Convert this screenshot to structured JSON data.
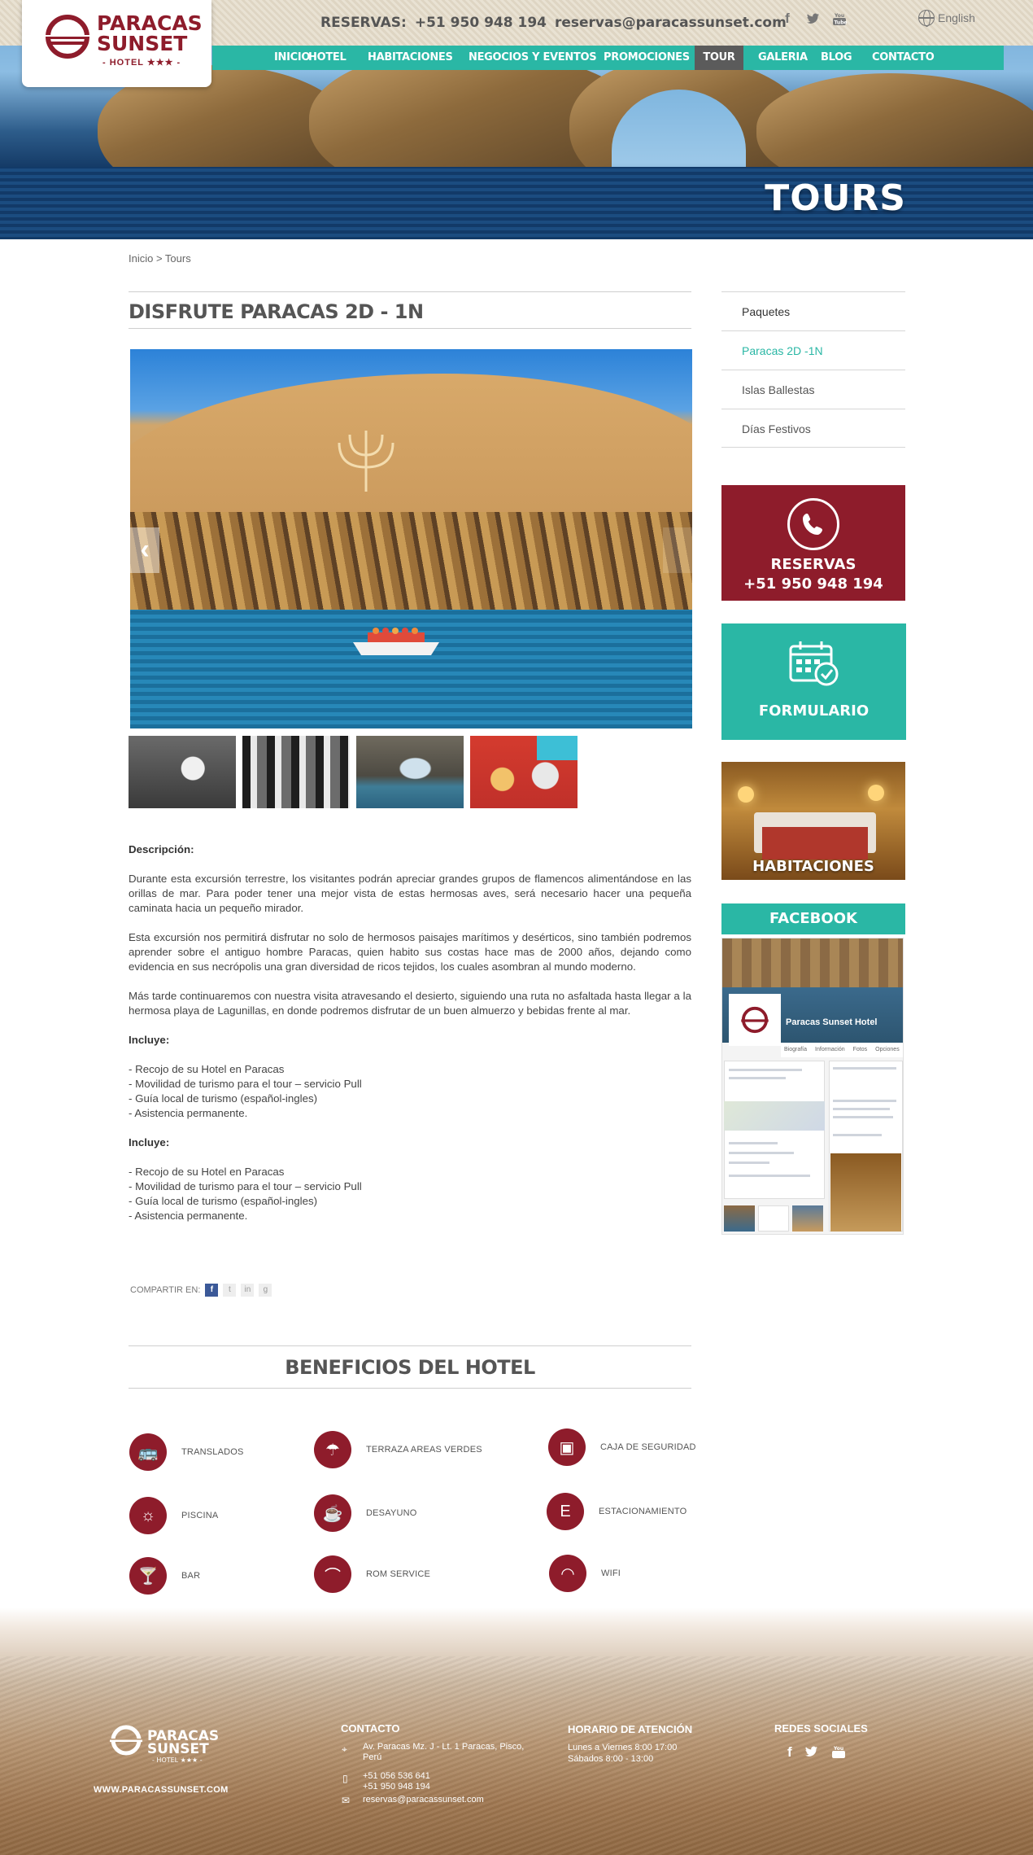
{
  "header": {
    "logo": {
      "line1": "PARACAS",
      "line2": "SUNSET",
      "sub": "- HOTEL ★★★ -"
    },
    "reservas_label": "RESERVAS:",
    "phone": "+51 950 948 194",
    "email": "reservas@paracassunset.com",
    "social_icons": [
      "facebook-icon",
      "twitter-icon",
      "youtube-icon"
    ],
    "language": "English",
    "nav": [
      {
        "label": "INICIO",
        "active": false
      },
      {
        "label": "HOTEL",
        "active": false
      },
      {
        "label": "HABITACIONES",
        "active": false
      },
      {
        "label": "NEGOCIOS Y EVENTOS",
        "active": false
      },
      {
        "label": "PROMOCIONES",
        "active": false
      },
      {
        "label": "TOUR",
        "active": true
      },
      {
        "label": "GALERIA",
        "active": false
      },
      {
        "label": "BLOG",
        "active": false
      },
      {
        "label": "CONTACTO",
        "active": false
      }
    ],
    "hero_title": "TOURS"
  },
  "breadcrumb": "Inicio > Tours",
  "main": {
    "title": "DISFRUTE PARACAS 2D - 1N",
    "description_heading": "Descripción:",
    "paragraphs": [
      "Durante esta excursión terrestre, los visitantes podrán apreciar grandes grupos de flamencos alimentándose en las orillas de mar. Para poder tener una mejor vista de estas hermosas aves, será necesario hacer una pequeña caminata hacia un pequeño mirador.",
      "Esta excursión nos permitirá disfrutar no solo de hermosos paisajes marítimos y desérticos, sino también podremos aprender sobre el antiguo hombre Paracas, quien habito sus costas hace mas de 2000 años, dejando como evidencia en sus necrópolis una gran diversidad de ricos tejidos, los cuales asombran al mundo moderno.",
      "Más tarde continuaremos con nuestra visita atravesando el desierto, siguiendo una ruta no asfaltada hasta llegar a la hermosa playa de Lagunillas, en donde podremos disfrutar de un buen almuerzo y bebidas frente al mar."
    ],
    "includes_heading_1": "Incluye:",
    "includes_1": [
      "- Recojo de su Hotel en Paracas",
      "- Movilidad de turismo para el tour – servicio Pull",
      "- Guía local de turismo (español-ingles)",
      "- Asistencia permanente."
    ],
    "includes_heading_2": "Incluye:",
    "includes_2": [
      "- Recojo de su Hotel en Paracas",
      "- Movilidad de turismo para el tour – servicio Pull",
      "- Guía local de turismo (español-ingles)",
      "- Asistencia permanente."
    ],
    "share_label": "COMPARTIR EN:",
    "share_icons": [
      "f",
      "t",
      "in",
      "g"
    ]
  },
  "beneficios": {
    "title": "BENEFICIOS DEL HOTEL",
    "items": [
      {
        "label": "TRANSLADOS",
        "icon": "bus-icon",
        "glyph": "🚌"
      },
      {
        "label": "TERRAZA AREAS VERDES",
        "icon": "terrace-icon",
        "glyph": "☂"
      },
      {
        "label": "CAJA DE SEGURIDAD",
        "icon": "safe-icon",
        "glyph": "▣"
      },
      {
        "label": "PISCINA",
        "icon": "sun-icon",
        "glyph": "☼"
      },
      {
        "label": "DESAYUNO",
        "icon": "coffee-icon",
        "glyph": "☕"
      },
      {
        "label": "ESTACIONAMIENTO",
        "icon": "parking-icon",
        "glyph": "E"
      },
      {
        "label": "BAR",
        "icon": "cocktail-icon",
        "glyph": "🍸"
      },
      {
        "label": "ROM SERVICE",
        "icon": "room-service-icon",
        "glyph": "⌒"
      },
      {
        "label": "WIFI",
        "icon": "wifi-icon",
        "glyph": "◠"
      }
    ]
  },
  "sidebar": {
    "menu": [
      {
        "label": "Paquetes",
        "state": "head"
      },
      {
        "label": "Paracas 2D  -1N",
        "state": "active"
      },
      {
        "label": "Islas Ballestas",
        "state": ""
      },
      {
        "label": "Días Festivos",
        "state": ""
      }
    ],
    "reservas_title": "RESERVAS",
    "reservas_phone": "+51 950 948 194",
    "formulario": "FORMULARIO",
    "habitaciones": "HABITACIONES",
    "facebook": "FACEBOOK",
    "fb_page_name": "Paracas Sunset Hotel",
    "fb_tabs": [
      "Biografía",
      "Información",
      "Fotos",
      "Opciones"
    ]
  },
  "footer": {
    "website": "WWW.PARACASSUNSET.COM",
    "contacto_title": "CONTACTO",
    "address": "Av. Paracas Mz. J - Lt. 1 Paracas, Pisco, Perú",
    "phone1": "+51 056 536 641",
    "phone2": "+51 950 948 194",
    "email": "reservas@paracassunset.com",
    "horario_title": "HORARIO DE ATENCIÓN",
    "horario_1": "Lunes a Viernes 8:00  17:00",
    "horario_2": "Sábados 8:00  - 13:00",
    "redes_title": "REDES SOCIALES"
  },
  "colors": {
    "brand_red": "#8e1c2b",
    "teal": "#2ab7a5",
    "nav_active": "#5b5b5b"
  }
}
